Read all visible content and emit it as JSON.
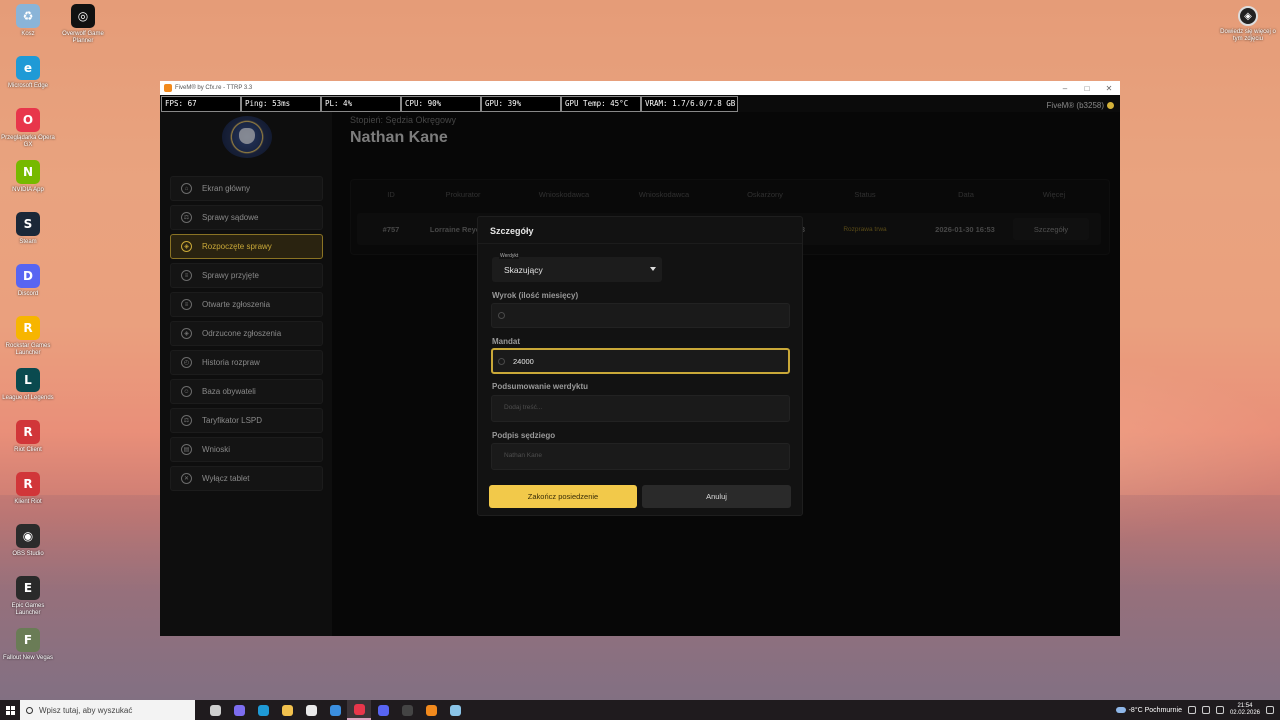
{
  "desktop": {
    "icons": [
      {
        "label": "Kosz",
        "color": "#8ab4d8",
        "glyph": "♻"
      },
      {
        "label": "Overwolf Game Planner",
        "color": "#111111",
        "glyph": "◎"
      },
      {
        "label": "Microsoft Edge",
        "color": "#1f9ad6",
        "glyph": "e"
      },
      {
        "label": "Przeglądarka Opera GX",
        "color": "#e8364b",
        "glyph": "O"
      },
      {
        "label": "NVIDIA App",
        "color": "#76b900",
        "glyph": "N"
      },
      {
        "label": "Steam",
        "color": "#1b2838",
        "glyph": "S"
      },
      {
        "label": "Discord",
        "color": "#5865f2",
        "glyph": "D"
      },
      {
        "label": "Rockstar Games Launcher",
        "color": "#f7b500",
        "glyph": "R"
      },
      {
        "label": "League of Legends",
        "color": "#0a4a4f",
        "glyph": "L"
      },
      {
        "label": "Riot Client",
        "color": "#d13639",
        "glyph": "R"
      },
      {
        "label": "Klient Riot",
        "color": "#d13639",
        "glyph": "R"
      },
      {
        "label": "OBS Studio",
        "color": "#2b2b2b",
        "glyph": "◉"
      },
      {
        "label": "Epic Games Launcher",
        "color": "#2a2a2a",
        "glyph": "E"
      },
      {
        "label": "Fallout New Vegas",
        "color": "#6a7c56",
        "glyph": "F"
      }
    ],
    "top_right_icon": {
      "label": "Dowiedz się więcej o tym zdjęciu",
      "glyph": "◈"
    }
  },
  "window": {
    "title": "FiveM® by Cfx.re - TTRP 3.3",
    "controls": [
      "–",
      "□",
      "✕"
    ],
    "fivem_badge": "FiveM® (b3258)"
  },
  "stats": {
    "fps": "FPS: 67",
    "ping": "Ping: 53ms",
    "pl": "PL: 4%",
    "cpu": "CPU: 90%",
    "gpu": "GPU: 39%",
    "gpu_temp": "GPU Temp: 45°C",
    "vram": "VRAM: 1.7/6.0/7.8 GB"
  },
  "header": {
    "rank": "Stopień: Sędzia Okręgowy",
    "name": "Nathan Kane"
  },
  "sidebar": {
    "items": [
      {
        "label": "Ekran główny",
        "icon": "home-icon",
        "glyph": "⌂"
      },
      {
        "label": "Sprawy sądowe",
        "icon": "gavel-icon",
        "glyph": "⚖"
      },
      {
        "label": "Rozpoczęte sprawy",
        "icon": "shield-icon",
        "glyph": "◈"
      },
      {
        "label": "Sprawy przyjęte",
        "icon": "document-icon",
        "glyph": "≡"
      },
      {
        "label": "Otwarte zgłoszenia",
        "icon": "document-icon",
        "glyph": "≡"
      },
      {
        "label": "Odrzucone zgłoszenia",
        "icon": "shield-icon",
        "glyph": "◈"
      },
      {
        "label": "Historia rozpraw",
        "icon": "clock-icon",
        "glyph": "◴"
      },
      {
        "label": "Baza obywateli",
        "icon": "users-icon",
        "glyph": "☺"
      },
      {
        "label": "Taryfikator LSPD",
        "icon": "gavel-icon",
        "glyph": "⚖"
      },
      {
        "label": "Wnioski",
        "icon": "inbox-icon",
        "glyph": "▤"
      },
      {
        "label": "Wyłącz tablet",
        "icon": "close-icon",
        "glyph": "✕"
      }
    ],
    "active_index": 2
  },
  "table": {
    "headers": [
      "ID",
      "Prokurator",
      "Wnioskodawca",
      "Wnioskodawca",
      "Oskarżony",
      "Status",
      "Data",
      "Więcej"
    ],
    "row": {
      "id": "#757",
      "prosecutor": "Lorraine Reyes",
      "defendant_suffix": "3",
      "status": "Rozprawa trwa",
      "date": "2026-01-30 16:53",
      "more": "Szczegóły"
    }
  },
  "modal": {
    "title": "Szczegóły",
    "verdict_label": "Werdykt",
    "verdict_value": "Skazujący",
    "sentence_label": "Wyrok (ilość miesięcy)",
    "sentence_value": "",
    "fine_label": "Mandat",
    "fine_value": "24000",
    "summary_label": "Podsumowanie werdyktu",
    "summary_placeholder": "Dodaj treść...",
    "signature_label": "Podpis sędziego",
    "signature_placeholder": "Nathan Kane",
    "finish_button": "Zakończ posiedzenie",
    "cancel_button": "Anuluj"
  },
  "taskbar": {
    "search_placeholder": "Wpisz tutaj, aby wyszukać",
    "apps": [
      {
        "name": "task-view",
        "color": "#cfcfcf"
      },
      {
        "name": "copilot",
        "color": "#7d6df0"
      },
      {
        "name": "edge",
        "color": "#1f9ad6"
      },
      {
        "name": "file-explorer",
        "color": "#f2c14e"
      },
      {
        "name": "store",
        "color": "#eaeaea"
      },
      {
        "name": "mail",
        "color": "#3b8fe0"
      },
      {
        "name": "opera-gx",
        "color": "#e8364b"
      },
      {
        "name": "discord",
        "color": "#5865f2"
      },
      {
        "name": "obs",
        "color": "#444444"
      },
      {
        "name": "fivem",
        "color": "#f28a1d"
      },
      {
        "name": "notepad",
        "color": "#8ac4e8"
      }
    ],
    "active_app_index": 6,
    "weather": "-8°C  Pochmurnie",
    "time": "21:54",
    "date": "02.02.2026"
  }
}
